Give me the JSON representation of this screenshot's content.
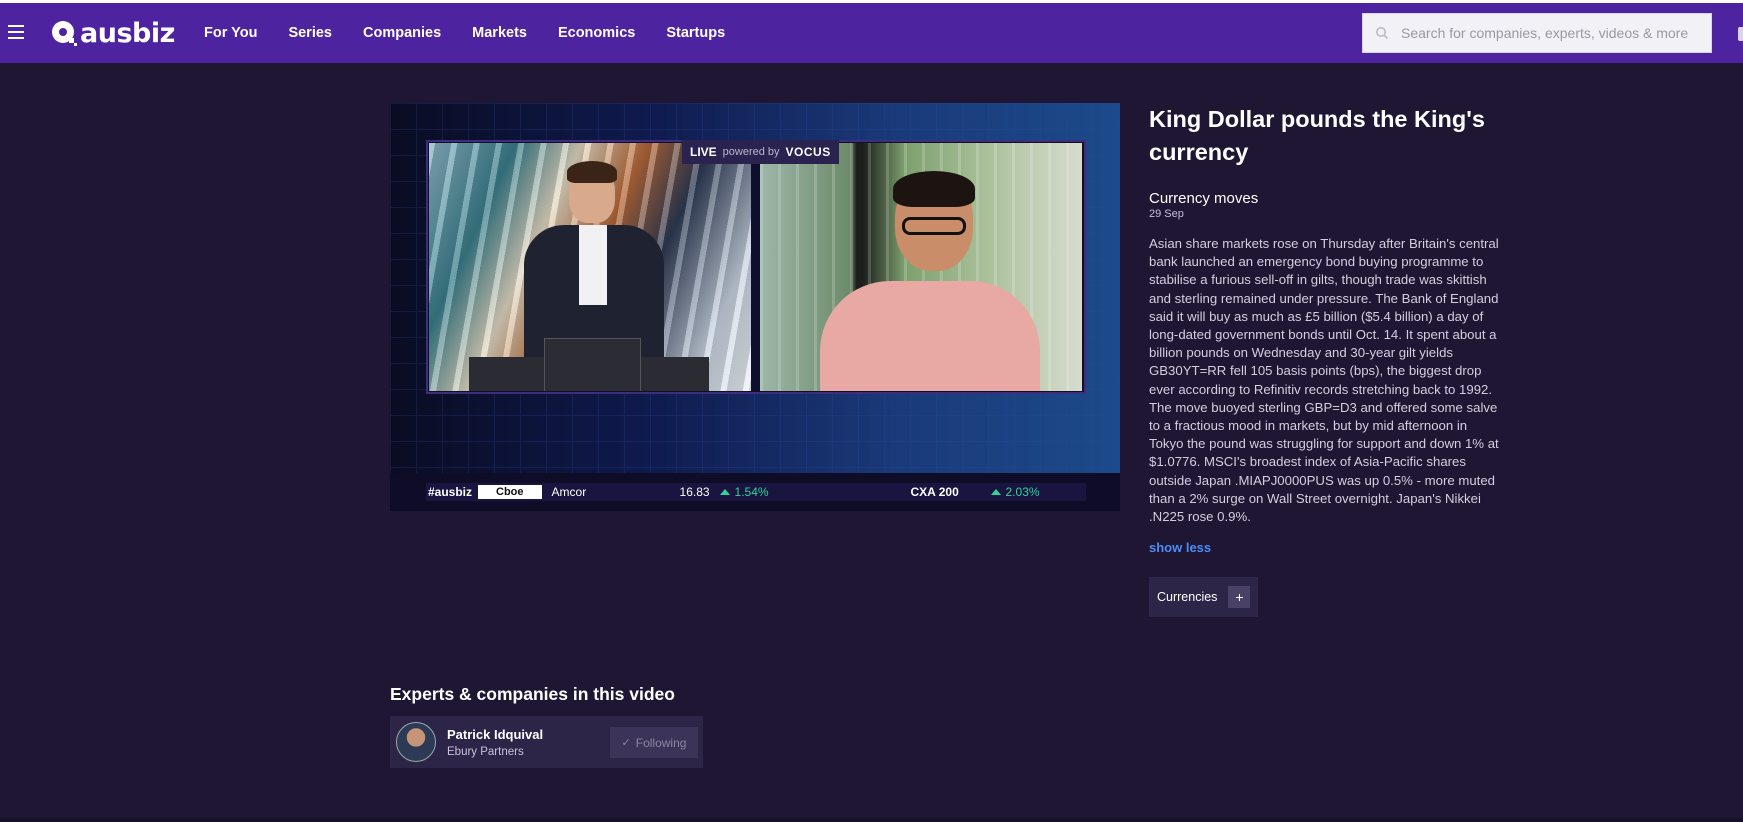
{
  "site": {
    "logo_text": "ausbiz",
    "brand_color": "#4e23a0",
    "background": "#1e1633"
  },
  "nav": {
    "items": [
      "For You",
      "Series",
      "Companies",
      "Markets",
      "Economics",
      "Startups"
    ]
  },
  "search": {
    "placeholder": "Search for companies, experts, videos & more"
  },
  "video": {
    "live_label": "LIVE",
    "powered_by": "powered by",
    "sponsor": "VOCUS",
    "ticker": {
      "brand": "#ausbiz",
      "partner": "Cboe",
      "stock_name": "Amcor",
      "stock_price": "16.83",
      "stock_change": "1.54%",
      "index_name": "CXA 200",
      "index_change": "2.03%"
    }
  },
  "article": {
    "title": "King Dollar pounds the King's currency",
    "series": "Currency moves",
    "date": "29 Sep",
    "description": "Asian share markets rose on Thursday after Britain's central bank launched an emergency bond buying programme to stabilise a furious sell-off in gilts, though trade was skittish and sterling remained under pressure. The Bank of England said it will buy as much as £5 billion ($5.4 billion) a day of long-dated government bonds until Oct. 14. It spent about a billion pounds on Wednesday and 30-year gilt yields GB30YT=RR fell 105 basis points (bps), the biggest drop ever according to Refinitiv records stretching back to 1992. The move buoyed sterling GBP=D3 and offered some salve to a fractious mood in markets, but by mid afternoon in Tokyo the pound was struggling for support and down 1% at $1.0776. MSCI's broadest index of Asia-Pacific shares outside Japan .MIAPJ0000PUS was up 0.5% - more muted than a 2% surge on Wall Street overnight. Japan's Nikkei .N225 rose 0.9%.",
    "show_less": "show less",
    "tag": "Currencies",
    "tag_plus": "+"
  },
  "experts": {
    "heading": "Experts & companies in this video",
    "items": [
      {
        "name": "Patrick Idquival",
        "company": "Ebury Partners",
        "follow_label": "Following",
        "follow_icon": "check-icon"
      }
    ]
  }
}
